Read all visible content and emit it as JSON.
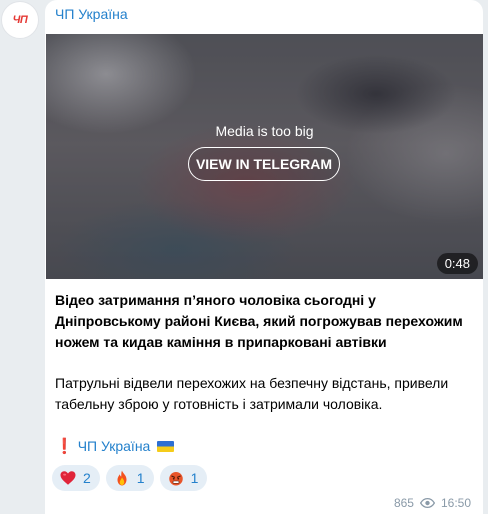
{
  "channel": {
    "name": "ЧП Україна",
    "avatar_text": "ЧП"
  },
  "media": {
    "notice": "Media is too big",
    "button_label": "VIEW IN TELEGRAM",
    "duration": "0:48"
  },
  "message": {
    "headline": "Відео затримання п’яного чоловіка сьогодні у Дніпровському районі Києва, який погрожував перехожим ножем та кидав каміння в припарковані автівки",
    "body": "Патрульні відвели перехожих на безпечну відстань, привели табельну зброю у готовність і затримали чоловіка.",
    "signature": {
      "mark": "❗",
      "link_text": "ЧП Україна",
      "flag_icon": "ukraine-flag-icon"
    }
  },
  "reactions": [
    {
      "icon": "heart-icon",
      "count": "2"
    },
    {
      "icon": "fire-icon",
      "count": "1"
    },
    {
      "icon": "angry-face-icon",
      "count": "1"
    }
  ],
  "meta": {
    "views": "865",
    "time": "16:50"
  },
  "colors": {
    "link": "#2481cc",
    "background": "#e9edf0",
    "bubble": "#ffffff",
    "reaction_bg": "#e5eef6",
    "meta": "#8a9aa8"
  }
}
